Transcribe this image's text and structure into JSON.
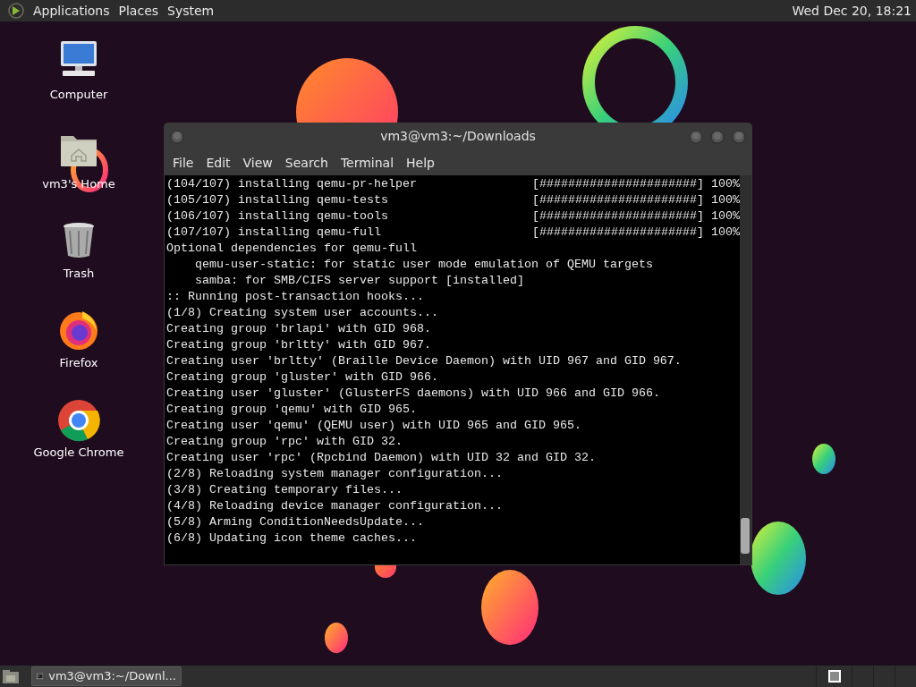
{
  "top_panel": {
    "menus": [
      "Applications",
      "Places",
      "System"
    ],
    "clock": "Wed Dec 20, 18:21"
  },
  "desktop_icons": [
    {
      "kind": "computer",
      "label": "Computer"
    },
    {
      "kind": "home",
      "label": "vm3's Home"
    },
    {
      "kind": "trash",
      "label": "Trash"
    },
    {
      "kind": "firefox",
      "label": "Firefox"
    },
    {
      "kind": "chrome",
      "label": "Google Chrome"
    }
  ],
  "terminal": {
    "title": "vm3@vm3:~/Downloads",
    "menu": [
      "File",
      "Edit",
      "View",
      "Search",
      "Terminal",
      "Help"
    ],
    "lines": [
      {
        "kind": "progress",
        "text": "(104/107) installing qemu-pr-helper",
        "bar": "[######################]",
        "percent": "100%"
      },
      {
        "kind": "progress",
        "text": "(105/107) installing qemu-tests",
        "bar": "[######################]",
        "percent": "100%"
      },
      {
        "kind": "progress",
        "text": "(106/107) installing qemu-tools",
        "bar": "[######################]",
        "percent": "100%"
      },
      {
        "kind": "progress",
        "text": "(107/107) installing qemu-full",
        "bar": "[######################]",
        "percent": "100%"
      },
      {
        "kind": "text",
        "text": "Optional dependencies for qemu-full"
      },
      {
        "kind": "text",
        "text": "    qemu-user-static: for static user mode emulation of QEMU targets"
      },
      {
        "kind": "text",
        "text": "    samba: for SMB/CIFS server support [installed]"
      },
      {
        "kind": "text",
        "text": ":: Running post-transaction hooks..."
      },
      {
        "kind": "text",
        "text": "(1/8) Creating system user accounts..."
      },
      {
        "kind": "text",
        "text": "Creating group 'brlapi' with GID 968."
      },
      {
        "kind": "text",
        "text": "Creating group 'brltty' with GID 967."
      },
      {
        "kind": "text",
        "text": "Creating user 'brltty' (Braille Device Daemon) with UID 967 and GID 967."
      },
      {
        "kind": "text",
        "text": "Creating group 'gluster' with GID 966."
      },
      {
        "kind": "text",
        "text": "Creating user 'gluster' (GlusterFS daemons) with UID 966 and GID 966."
      },
      {
        "kind": "text",
        "text": "Creating group 'qemu' with GID 965."
      },
      {
        "kind": "text",
        "text": "Creating user 'qemu' (QEMU user) with UID 965 and GID 965."
      },
      {
        "kind": "text",
        "text": "Creating group 'rpc' with GID 32."
      },
      {
        "kind": "text",
        "text": "Creating user 'rpc' (Rpcbind Daemon) with UID 32 and GID 32."
      },
      {
        "kind": "text",
        "text": "(2/8) Reloading system manager configuration..."
      },
      {
        "kind": "text",
        "text": "(3/8) Creating temporary files..."
      },
      {
        "kind": "text",
        "text": "(4/8) Reloading device manager configuration..."
      },
      {
        "kind": "text",
        "text": "(5/8) Arming ConditionNeedsUpdate..."
      },
      {
        "kind": "text",
        "text": "(6/8) Updating icon theme caches..."
      }
    ]
  },
  "taskbar": {
    "tasks": [
      {
        "label": "vm3@vm3:~/Downl...",
        "selected": true
      }
    ]
  }
}
